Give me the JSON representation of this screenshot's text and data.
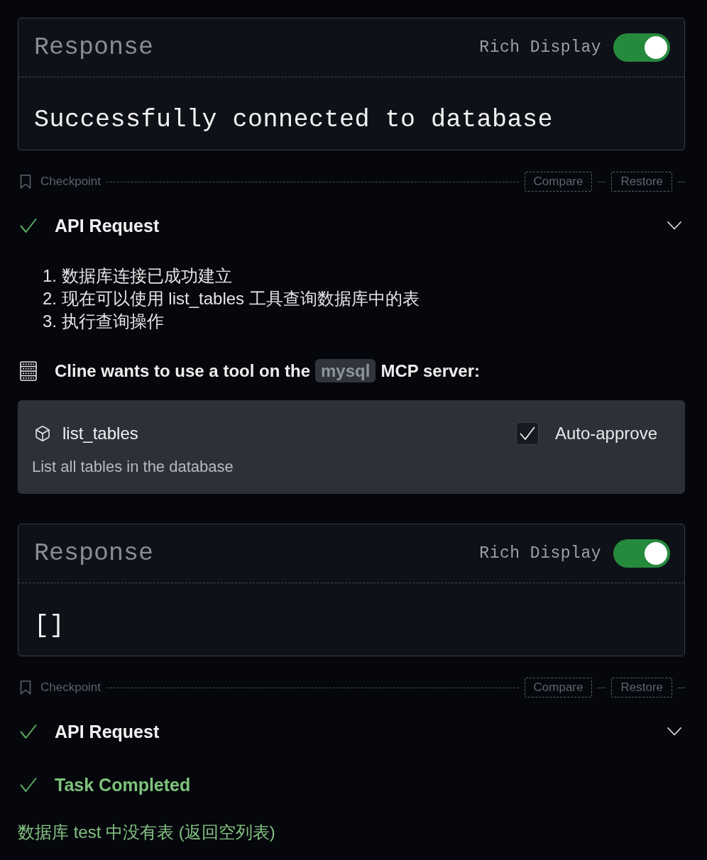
{
  "feed": [
    {
      "kind": "response",
      "title": "Response",
      "rich_display": {
        "label": "Rich Display",
        "on": true
      },
      "body": "Successfully connected to database"
    },
    {
      "kind": "checkpoint",
      "label": "Checkpoint",
      "actions": [
        "Compare",
        "Restore"
      ]
    },
    {
      "kind": "api_request",
      "title": "API Request",
      "done": true,
      "expanded": false
    },
    {
      "kind": "list",
      "items": [
        "1. 数据库连接已成功建立",
        "2. 现在可以使用 list_tables 工具查询数据库中的表",
        "3. 执行查询操作"
      ]
    },
    {
      "kind": "tool_use",
      "message_prefix": "Cline wants to use a tool on the",
      "server": "mysql",
      "message_suffix": "MCP server:",
      "tool": {
        "name": "list_tables",
        "description": "List all tables in the database",
        "auto_approve": {
          "label": "Auto-approve",
          "checked": true
        }
      }
    },
    {
      "kind": "response",
      "title": "Response",
      "rich_display": {
        "label": "Rich Display",
        "on": true
      },
      "body": "[]"
    },
    {
      "kind": "checkpoint",
      "label": "Checkpoint",
      "actions": [
        "Compare",
        "Restore"
      ]
    },
    {
      "kind": "api_request",
      "title": "API Request",
      "done": true,
      "expanded": false
    },
    {
      "kind": "completion",
      "title": "Task Completed",
      "text": "数据库 test 中没有表 (返回空列表)"
    }
  ]
}
